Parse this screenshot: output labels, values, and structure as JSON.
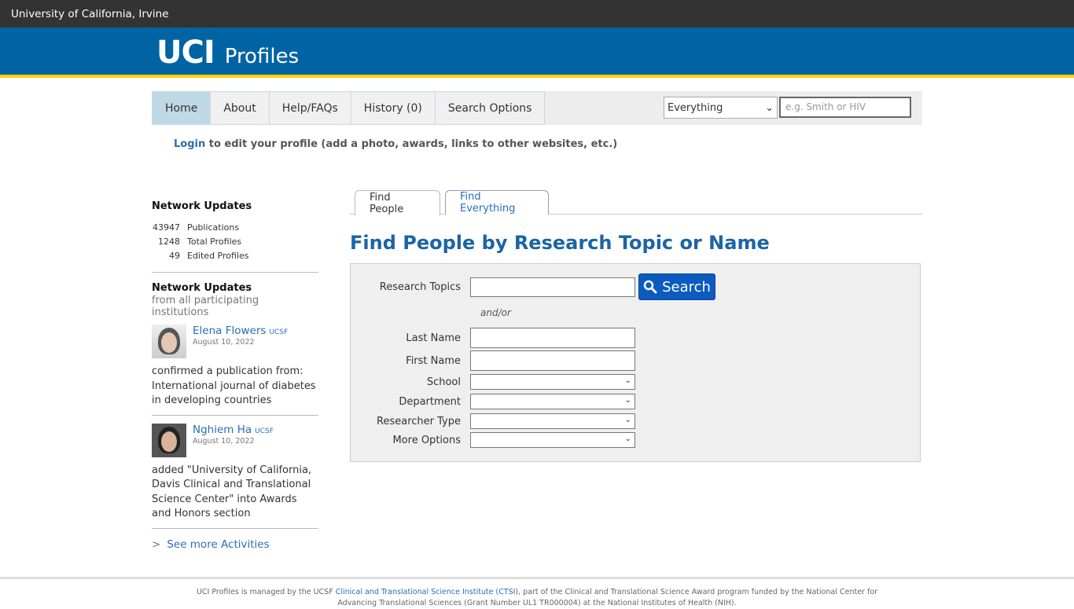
{
  "topbar": {
    "title": "University of California, Irvine"
  },
  "brand": {
    "logo_text": "UCI",
    "product": "Profiles"
  },
  "nav": {
    "items": [
      "Home",
      "About",
      "Help/FAQs",
      "History (0)",
      "Search Options"
    ]
  },
  "topsearch": {
    "scope": "Everything",
    "placeholder": "e.g. Smith or HIV"
  },
  "login": {
    "link": "Login",
    "text": " to edit your profile (add a photo, awards, links to other websites, etc.)"
  },
  "sidebar": {
    "stats_title": "Network Updates",
    "stats": [
      {
        "num": "43947",
        "label": "Publications"
      },
      {
        "num": "1248",
        "label": "Total Profiles"
      },
      {
        "num": "49",
        "label": "Edited Profiles"
      }
    ],
    "updates_title": "Network Updates",
    "updates_sub": "from all participating institutions",
    "activities": [
      {
        "name": "Elena Flowers",
        "inst": "UCSF",
        "date": "August 10, 2022",
        "text": "confirmed a publication from: International journal of diabetes in developing countries"
      },
      {
        "name": "Nghiem Ha",
        "inst": "UCSF",
        "date": "August 10, 2022",
        "text": "added \"University of California, Davis Clinical and Translational Science Center\" into Awards and Honors section"
      }
    ],
    "more": "See more Activities"
  },
  "tabs": {
    "find_people": "Find People",
    "find_everything": "Find Everything"
  },
  "main": {
    "title": "Find People by Research Topic or Name",
    "research_topics": "Research Topics",
    "search_button": "Search",
    "andor": "and/or",
    "last_name": "Last Name",
    "first_name": "First Name",
    "school": "School",
    "department": "Department",
    "researcher_type": "Researcher Type",
    "more_options": "More Options"
  },
  "footer": {
    "text1": "UCI Profiles is managed by the UCSF ",
    "link": "Clinical and Translational Science Institute (CTSI)",
    "text2": ", part of the Clinical and Translational Science Award program funded by the National Center for",
    "text3": "Advancing Translational Sciences (Grant Number UL1 TR000004) at the National Institutes of Health (NIH)."
  }
}
